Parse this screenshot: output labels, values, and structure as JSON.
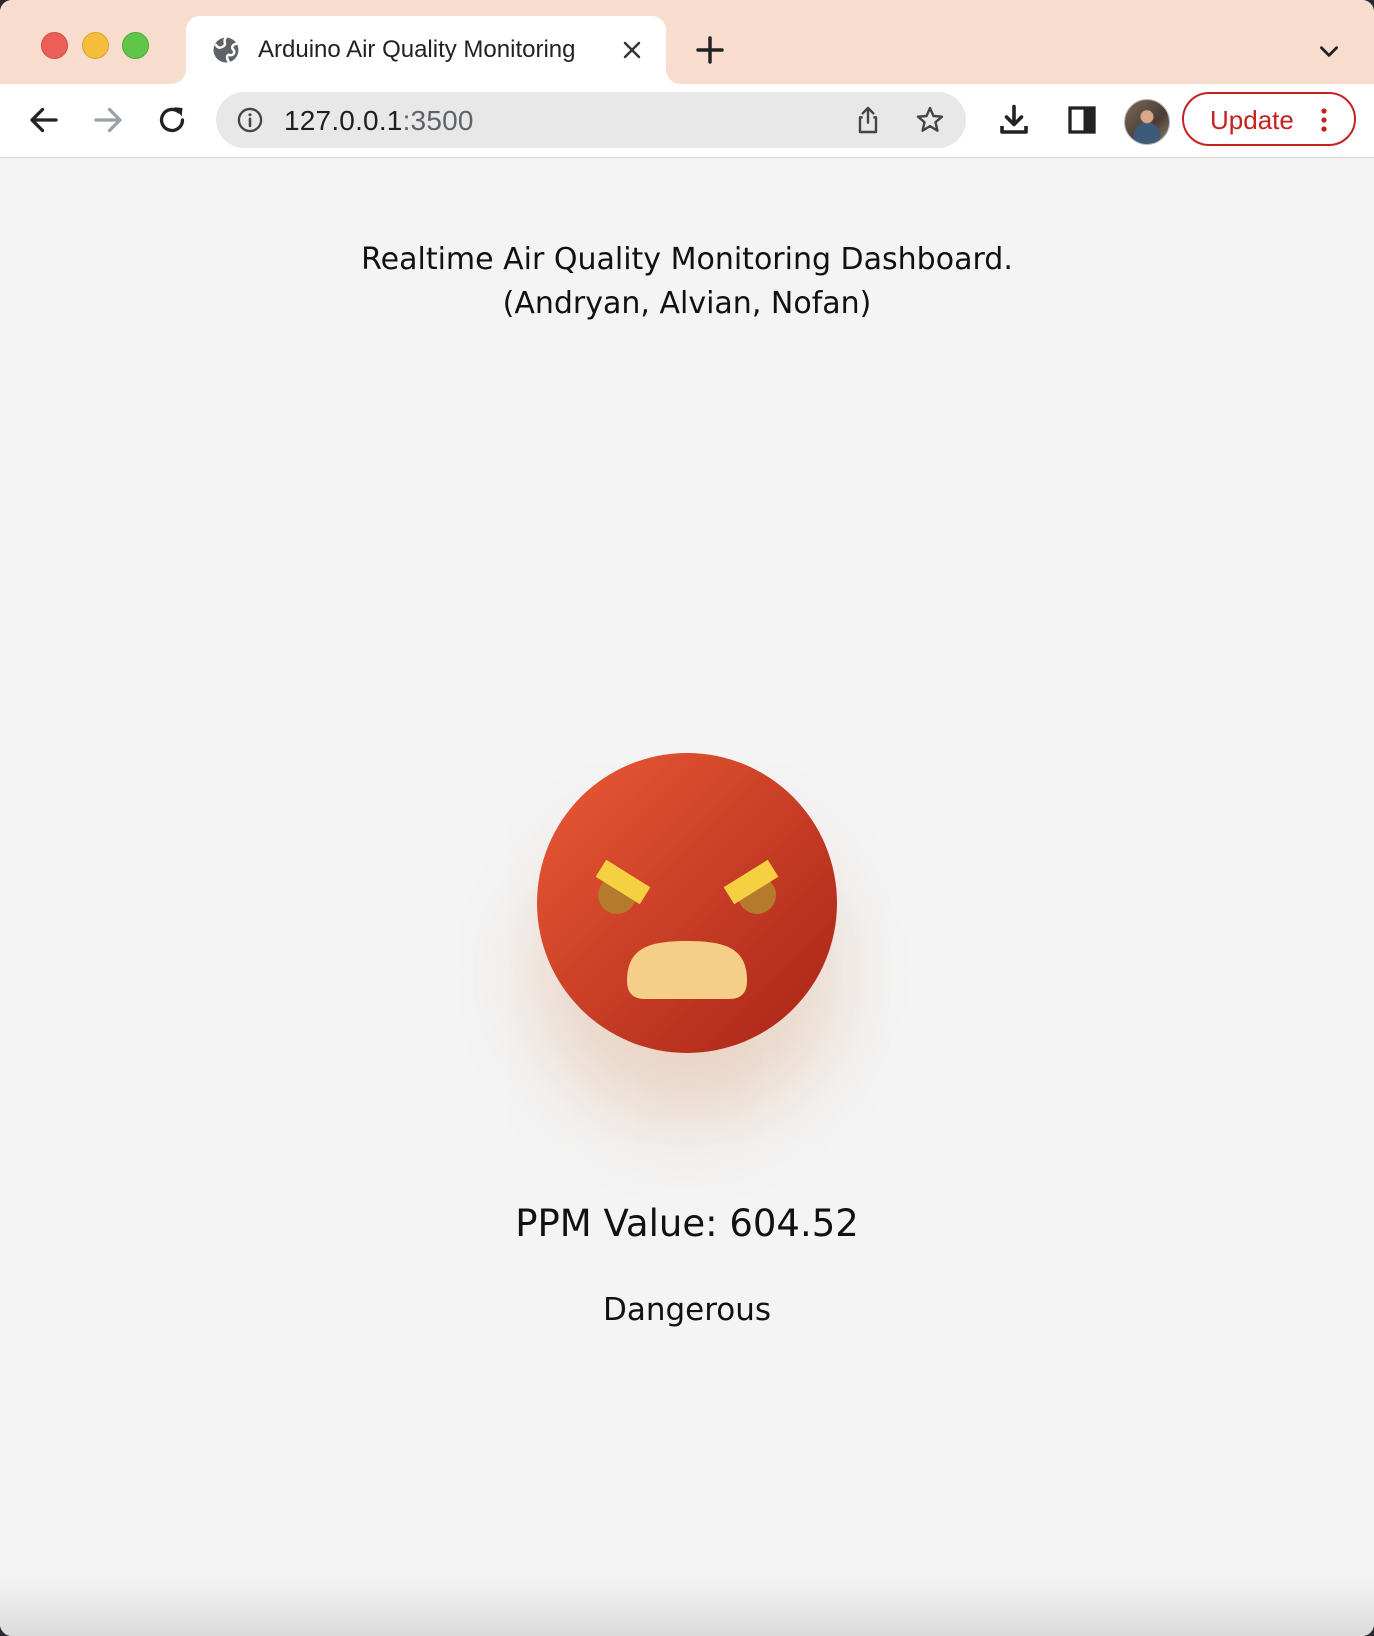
{
  "browser": {
    "tab": {
      "title": "Arduino Air Quality Monitoring",
      "icon": "globe-icon"
    },
    "address_bar": {
      "host": "127.0.0.1",
      "port": ":3500"
    },
    "update_button": {
      "label": "Update"
    },
    "colors": {
      "tabstrip": "#f8dccd",
      "update_accent": "#c5221f"
    }
  },
  "page": {
    "heading_line1": "Realtime Air Quality Monitoring Dashboard.",
    "heading_line2": "(Andryan, Alvian, Nofan)",
    "status_icon": "angry-face-icon",
    "ppm_text": "PPM Value: 604.52",
    "status_text": "Dangerous",
    "colors": {
      "face_top": "#e05232",
      "face_bottom": "#b42a1a",
      "brows": "#f5d142",
      "eyes": "#b57a2b",
      "mouth": "#f5cf87",
      "background": "#f4f4f4"
    }
  }
}
